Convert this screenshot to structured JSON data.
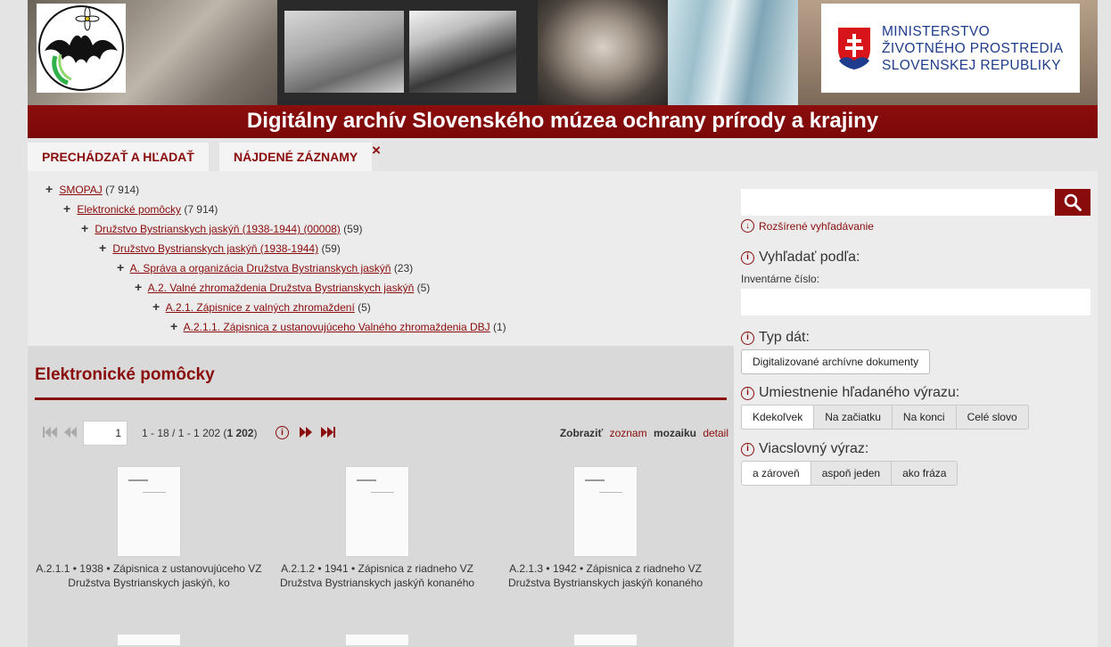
{
  "header": {
    "ministry_lines": [
      "MINISTERSTVO",
      "ŽIVOTNÉHO PROSTREDIA",
      "SLOVENSKEJ REPUBLIKY"
    ],
    "title": "Digitálny archív Slovenského múzea ochrany prírody a krajiny"
  },
  "tabs": [
    {
      "label": "PRECHÁDZAŤ A HĽADAŤ"
    },
    {
      "label": "NÁJDENÉ ZÁZNAMY"
    }
  ],
  "tabs_close": "×",
  "tree": [
    {
      "label": "SMOPAJ",
      "count": "(7 914)",
      "level": 0
    },
    {
      "label": "Elektronické pomôcky",
      "count": "(7 914)",
      "level": 1
    },
    {
      "label": "Družstvo Bystrianskych jaskýň (1938-1944) (00008)",
      "count": "(59)",
      "level": 2
    },
    {
      "label": "Družstvo Bystrianskych jaskýň (1938-1944)",
      "count": "(59)",
      "level": 3
    },
    {
      "label": "A. Správa a organizácia Družstva Bystrianskych jaskýň",
      "count": "(23)",
      "level": 4
    },
    {
      "label": "A.2. Valné zhromaždenia Družstva Bystrianskych jaskýň",
      "count": "(5)",
      "level": 5
    },
    {
      "label": "A.2.1. Zápisnice z valných zhromaždení",
      "count": "(5)",
      "level": 6
    },
    {
      "label": "A.2.1.1. Zápisnica z ustanovujúceho Valného zhromaždenia DBJ",
      "count": "(1)",
      "level": 7
    }
  ],
  "results": {
    "heading": "Elektronické pomôcky",
    "pager": {
      "page": "1",
      "range": "1 - 18",
      "sep": "/",
      "total_range": "1 - 1 202",
      "total": "1 202"
    },
    "view": {
      "label": "Zobraziť",
      "options": [
        {
          "label": "zoznam",
          "active": false
        },
        {
          "label": "mozaiku",
          "active": true
        },
        {
          "label": "detail",
          "active": false
        }
      ]
    },
    "items": [
      {
        "caption": "A.2.1.1 • 1938 • Zápisnica z ustanovujúceho VZ Družstva Bystrianskych jaskýň, ko"
      },
      {
        "caption": "A.2.1.2 • 1941 • Zápisnica z riadneho VZ Družstva Bystrianskych jaskýň konaného"
      },
      {
        "caption": "A.2.1.3 • 1942 • Zápisnica z riadneho VZ Družstva Bystrianskych jaskýň konaného"
      }
    ]
  },
  "sidebar": {
    "search_placeholder": "",
    "advanced_label": "Rozšírené vyhľadávanie",
    "search_by": {
      "heading": "Vyhľadať podľa:",
      "field_label": "Inventárne číslo:",
      "value": ""
    },
    "data_type": {
      "heading": "Typ dát:",
      "button": "Digitalizované archívne dokumenty"
    },
    "placement": {
      "heading": "Umiestnenie hľadaného výrazu:",
      "options": [
        {
          "label": "Kdekoľvek",
          "active": true
        },
        {
          "label": "Na začiatku",
          "active": false
        },
        {
          "label": "Na konci",
          "active": false
        },
        {
          "label": "Celé slovo",
          "active": false
        }
      ]
    },
    "multiword": {
      "heading": "Viacslovný výraz:",
      "options": [
        {
          "label": "a zároveň",
          "active": true
        },
        {
          "label": "aspoň jeden",
          "active": false
        },
        {
          "label": "ako fráza",
          "active": false
        }
      ]
    }
  },
  "colors": {
    "brand_red": "#8a0b0b",
    "ministry_blue": "#1f3c8c"
  }
}
